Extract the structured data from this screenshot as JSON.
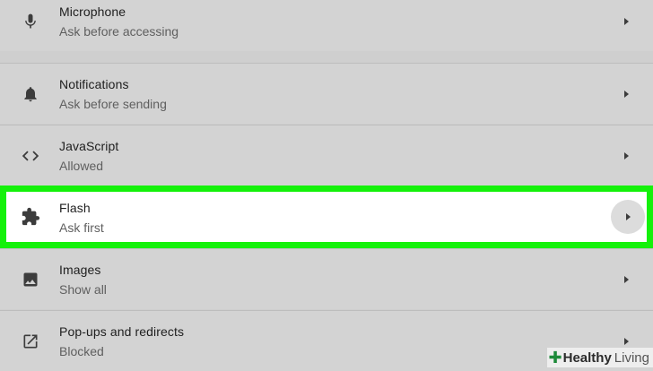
{
  "rows": [
    {
      "title": "Microphone",
      "subtitle": "Ask before accessing",
      "icon": "microphone-icon"
    },
    {
      "title": "Notifications",
      "subtitle": "Ask before sending",
      "icon": "bell-icon"
    },
    {
      "title": "JavaScript",
      "subtitle": "Allowed",
      "icon": "code-brackets-icon"
    },
    {
      "title": "Flash",
      "subtitle": "Ask first",
      "icon": "puzzle-piece-icon"
    },
    {
      "title": "Images",
      "subtitle": "Show all",
      "icon": "image-icon"
    },
    {
      "title": "Pop-ups and redirects",
      "subtitle": "Blocked",
      "icon": "open-in-new-icon"
    }
  ],
  "watermark": {
    "bold": "Healthy",
    "light": "Living"
  },
  "colors": {
    "highlight": "#14f10a",
    "background": "#d3d3d3",
    "icon": "#3c3c3c"
  }
}
